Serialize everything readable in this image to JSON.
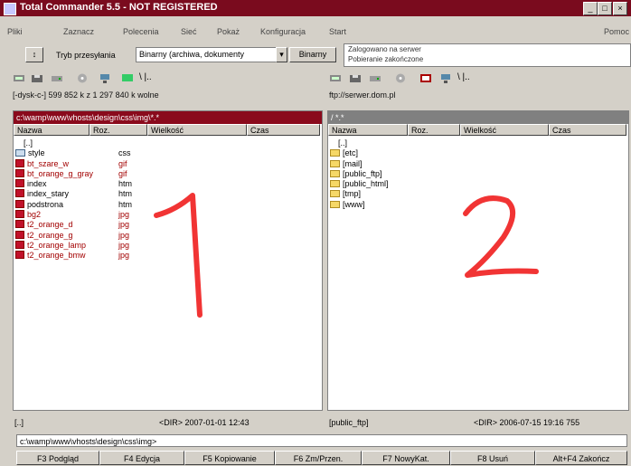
{
  "window": {
    "title": "Total Commander 5.5 - NOT REGISTERED",
    "controls": [
      "_",
      "□",
      "×"
    ]
  },
  "menu": {
    "items": [
      "Pliki",
      "Zaznacz",
      "Polecenia",
      "Sieć",
      "Pokaż",
      "Konfiguracja",
      "Start"
    ],
    "right": "Pomoc"
  },
  "options": {
    "label": "Tryb przesyłania",
    "mode_value": "Binarny (archiwa, dokumenty",
    "button": "Binarny",
    "info_line1": "Zalogowano na serwer",
    "info_line2": "Pobieranie zakończone"
  },
  "left_panel": {
    "drive": "[-dysk-c-]",
    "free": "599 852 k z 1 297 840 k wolne",
    "path": "c:\\wamp\\www\\vhosts\\design\\css\\img\\*.*",
    "columns": [
      "Nazwa",
      "Roz.",
      "Wielkość",
      "Czas"
    ],
    "rows": [
      {
        "name": "[..]",
        "ext": "",
        "icon": "up"
      },
      {
        "name": "style",
        "ext": "css",
        "icon": "file-blue"
      },
      {
        "name": "bt_szare_w",
        "ext": "gif",
        "icon": "file"
      },
      {
        "name": "bt_orange_g_gray",
        "ext": "gif",
        "icon": "file"
      },
      {
        "name": "index",
        "ext": "htm",
        "icon": "file"
      },
      {
        "name": "index_stary",
        "ext": "htm",
        "icon": "file"
      },
      {
        "name": "podstrona",
        "ext": "htm",
        "icon": "file"
      },
      {
        "name": "bg2",
        "ext": "jpg",
        "icon": "file"
      },
      {
        "name": "t2_orange_d",
        "ext": "jpg",
        "icon": "file"
      },
      {
        "name": "t2_orange_g",
        "ext": "jpg",
        "icon": "file"
      },
      {
        "name": "t2_orange_lamp",
        "ext": "jpg",
        "icon": "file"
      },
      {
        "name": "t2_orange_bmw",
        "ext": "jpg",
        "icon": "file"
      }
    ],
    "status": "[..]",
    "status_right": "<DIR>   2007-01-01 12:43"
  },
  "right_panel": {
    "drive": "ftp",
    "path_line": "ftp://serwer.dom.pl",
    "path": "/ *.*",
    "columns": [
      "Nazwa",
      "Roz.",
      "Wielkość",
      "Czas"
    ],
    "rows": [
      {
        "name": "[..]",
        "icon": "up"
      },
      {
        "name": "[etc]",
        "icon": "folder"
      },
      {
        "name": "[mail]",
        "icon": "folder"
      },
      {
        "name": "[public_ftp]",
        "icon": "folder"
      },
      {
        "name": "[public_html]",
        "icon": "folder"
      },
      {
        "name": "[tmp]",
        "icon": "folder"
      },
      {
        "name": "[www]",
        "icon": "folder"
      }
    ],
    "status": "[public_ftp]",
    "status_right": "<DIR>   2006-07-15 19:16 755"
  },
  "cmdline": "c:\\wamp\\www\\vhosts\\design\\css\\img>",
  "fkeys": [
    "F3 Podgląd",
    "F4 Edycja",
    "F5 Kopiowanie",
    "F6 Zm/Przen.",
    "F7 NowyKat.",
    "F8 Usuń",
    "Alt+F4 Zakończ"
  ],
  "annotations": {
    "left": "1",
    "right": "2"
  },
  "colors": {
    "titlebar": "#7a0b1e",
    "active_path": "#8a0a1c",
    "inactive_path": "#808080",
    "annotation": "#ee1111"
  }
}
